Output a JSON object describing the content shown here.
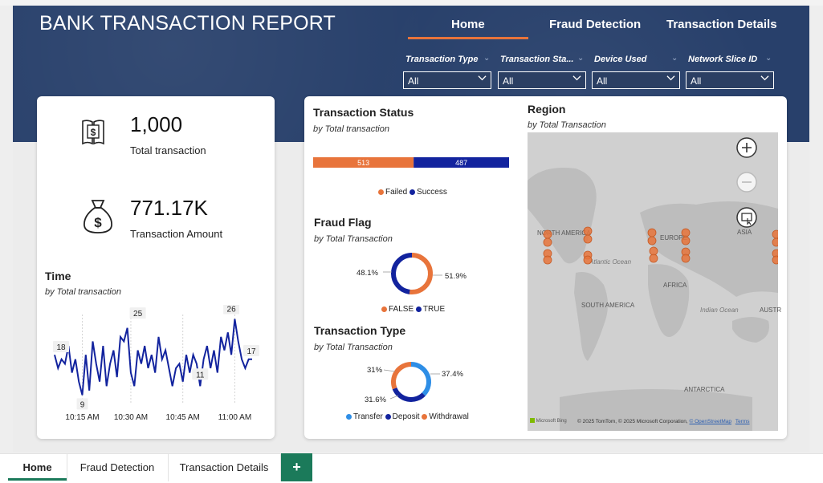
{
  "header": {
    "title": "BANK TRANSACTION REPORT",
    "nav": [
      "Home",
      "Fraud Detection",
      "Transaction Details"
    ]
  },
  "slicers": [
    {
      "label": "Transaction Type",
      "value": "All"
    },
    {
      "label": "Transaction Sta...",
      "value": "All"
    },
    {
      "label": "Device Used",
      "value": "All"
    },
    {
      "label": "Network Slice ID",
      "value": "All"
    }
  ],
  "kpis": {
    "total_transaction": {
      "value": "1,000",
      "label": "Total transaction",
      "icon": "ledger-dollar-icon"
    },
    "transaction_amount": {
      "value": "771.17K",
      "label": "Transaction Amount",
      "icon": "money-bag-icon"
    }
  },
  "time_chart": {
    "title": "Time",
    "subtitle": "by Total transaction",
    "x_ticks": [
      "10:15 AM",
      "10:30 AM",
      "10:45 AM",
      "11:00 AM"
    ],
    "labels": [
      "18",
      "9",
      "25",
      "11",
      "26",
      "17"
    ]
  },
  "transaction_status": {
    "title": "Transaction Status",
    "subtitle": "by Total transaction",
    "legend": [
      "Failed",
      "Success"
    ]
  },
  "fraud_flag": {
    "title": "Fraud Flag",
    "subtitle": "by Total Transaction",
    "legend": [
      "FALSE",
      "TRUE"
    ]
  },
  "transaction_type": {
    "title": "Transaction Type",
    "subtitle": "by Total Transaction",
    "legend": [
      "Transfer",
      "Deposit",
      "Withdrawal"
    ]
  },
  "region": {
    "title": "Region",
    "subtitle": "by Total Transaction",
    "map_labels": [
      "NORTH AMERICA",
      "EUROPE",
      "ASIA",
      "Atlantic Ocean",
      "AFRICA",
      "SOUTH AMERICA",
      "Indian Ocean",
      "AUSTR",
      "ANTARCTICA"
    ],
    "attribution": "© 2025 TomTom, © 2025 Microsoft Corporation, ",
    "osm": "© OpenStreetMap",
    "terms": "Terms",
    "bing": "Microsoft Bing"
  },
  "page_tabs": [
    "Home",
    "Fraud Detection",
    "Transaction Details",
    "+"
  ],
  "colors": {
    "orange": "#e8743b",
    "navy": "#12239e",
    "blue": "#2e8ee6",
    "banner": "#28406b"
  },
  "chart_data": [
    {
      "type": "line",
      "title": "Time",
      "subtitle": "by Total transaction",
      "x": [
        "10:08",
        "10:09",
        "10:10",
        "10:11",
        "10:12",
        "10:13",
        "10:14",
        "10:15",
        "10:16",
        "10:17",
        "10:18",
        "10:19",
        "10:20",
        "10:21",
        "10:22",
        "10:23",
        "10:24",
        "10:25",
        "10:26",
        "10:27",
        "10:28",
        "10:29",
        "10:30",
        "10:31",
        "10:32",
        "10:33",
        "10:34",
        "10:35",
        "10:36",
        "10:37",
        "10:38",
        "10:39",
        "10:40",
        "10:41",
        "10:42",
        "10:43",
        "10:44",
        "10:45",
        "10:46",
        "10:47",
        "10:48",
        "10:49",
        "10:50",
        "10:51",
        "10:52",
        "10:53",
        "10:54",
        "10:55",
        "10:56",
        "10:57",
        "10:58",
        "10:59",
        "11:00",
        "11:01"
      ],
      "series": [
        {
          "values": [
            18,
            15,
            17,
            16,
            20,
            14,
            17,
            12,
            9,
            18,
            10,
            21,
            16,
            12,
            20,
            11,
            16,
            19,
            13,
            22,
            21,
            24,
            14,
            11,
            19,
            16,
            20,
            15,
            18,
            14,
            22,
            17,
            19,
            15,
            11,
            15,
            16,
            12,
            18,
            14,
            18,
            16,
            11,
            17,
            20,
            15,
            19,
            14,
            22,
            19,
            23,
            18,
            26,
            21,
            17,
            15,
            17,
            17
          ]
        }
      ],
      "xlabel": "",
      "ylabel": "",
      "x_ticks": [
        "10:15 AM",
        "10:30 AM",
        "10:45 AM",
        "11:00 AM"
      ]
    },
    {
      "type": "bar",
      "title": "Transaction Status",
      "categories": [
        "Total transaction"
      ],
      "series": [
        {
          "name": "Failed",
          "values": [
            513
          ]
        },
        {
          "name": "Success",
          "values": [
            487
          ]
        }
      ]
    },
    {
      "type": "pie",
      "title": "Fraud Flag",
      "categories": [
        "FALSE",
        "TRUE"
      ],
      "values": [
        51.9,
        48.1
      ]
    },
    {
      "type": "pie",
      "title": "Transaction Type",
      "categories": [
        "Transfer",
        "Deposit",
        "Withdrawal"
      ],
      "values": [
        37.4,
        31.6,
        31.0
      ]
    }
  ]
}
